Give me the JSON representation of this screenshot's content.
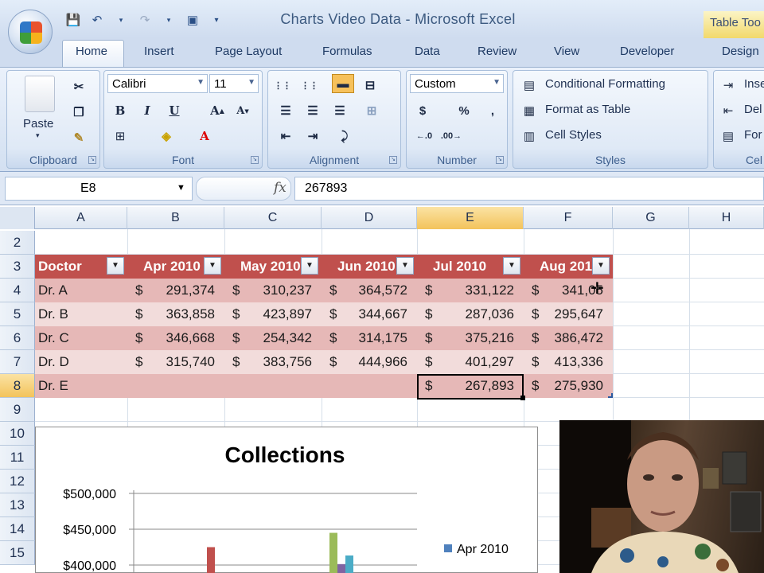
{
  "window": {
    "title": "Charts Video Data - Microsoft Excel",
    "contextual_tab": "Table Too"
  },
  "tabs": [
    {
      "label": "Home",
      "active": true
    },
    {
      "label": "Insert"
    },
    {
      "label": "Page Layout"
    },
    {
      "label": "Formulas"
    },
    {
      "label": "Data"
    },
    {
      "label": "Review"
    },
    {
      "label": "View"
    },
    {
      "label": "Developer"
    },
    {
      "label": "Design"
    }
  ],
  "ribbon": {
    "clipboard": {
      "label": "Clipboard",
      "paste": "Paste"
    },
    "font": {
      "label": "Font",
      "name": "Calibri",
      "size": "11"
    },
    "alignment": {
      "label": "Alignment"
    },
    "number": {
      "label": "Number",
      "format": "Custom",
      "currency": "$",
      "percent": "%",
      "comma": ","
    },
    "styles": {
      "label": "Styles",
      "conditional": "Conditional Formatting",
      "format_table": "Format as Table",
      "cell_styles": "Cell Styles"
    },
    "cells": {
      "label": "Cel",
      "insert": "Inse",
      "delete": "Del",
      "format": "For"
    }
  },
  "formula_bar": {
    "name_box": "E8",
    "fx": "fx",
    "value": "267893"
  },
  "columns": [
    "A",
    "B",
    "C",
    "D",
    "E",
    "F",
    "G",
    "H"
  ],
  "rows": [
    "2",
    "3",
    "4",
    "5",
    "6",
    "7",
    "8",
    "9",
    "10",
    "11",
    "12",
    "13",
    "14",
    "15"
  ],
  "table": {
    "headers": [
      "Doctor",
      "Apr 2010",
      "May 2010",
      "Jun 2010",
      "Jul 2010",
      "Aug 201"
    ],
    "data": [
      [
        "Dr. A",
        "291,374",
        "310,237",
        "364,572",
        "331,122",
        "341,05"
      ],
      [
        "Dr. B",
        "363,858",
        "423,897",
        "344,667",
        "287,036",
        "295,647"
      ],
      [
        "Dr. C",
        "346,668",
        "254,342",
        "314,175",
        "375,216",
        "386,472"
      ],
      [
        "Dr. D",
        "315,740",
        "383,756",
        "444,966",
        "401,297",
        "413,336"
      ],
      [
        "Dr. E",
        "",
        "",
        "",
        "267,893",
        "275,930"
      ]
    ],
    "currency": "$"
  },
  "chart_data": {
    "type": "bar",
    "title": "Collections",
    "yticks": [
      "$500,000",
      "$450,000",
      "$400,000"
    ],
    "ylim": [
      400000,
      500000
    ],
    "legend": [
      {
        "name": "Apr 2010",
        "color": "#4f81bd"
      }
    ],
    "visible_bars": [
      {
        "color": "#c0504d",
        "value": 425000
      },
      {
        "color": "#9bbb59",
        "value": 444966
      },
      {
        "color": "#8064a2",
        "value": 401297
      },
      {
        "color": "#4bacc6",
        "value": 413336
      }
    ]
  },
  "colors": {
    "header_fill": "#c0504d",
    "row_dark": "#e6b8b7",
    "row_light": "#f2dcdb",
    "selection": "#f3c35b"
  }
}
